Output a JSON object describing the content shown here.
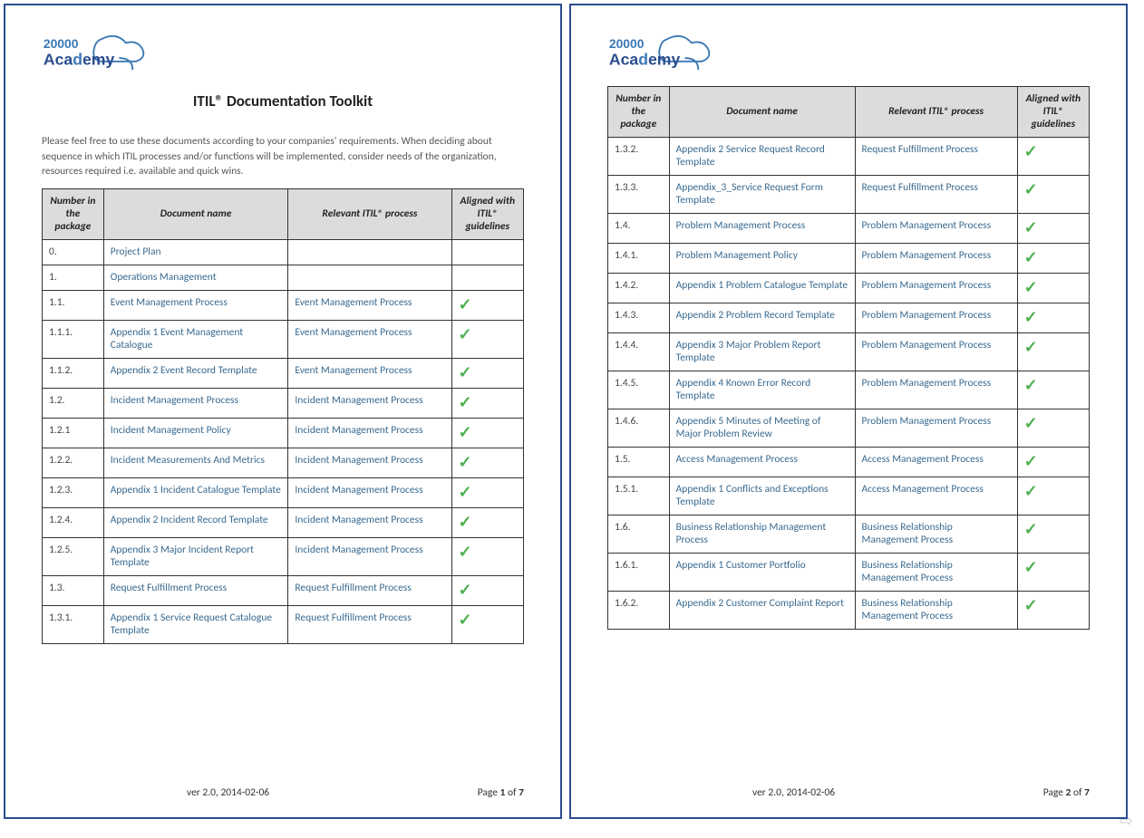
{
  "logo": {
    "top_text": "20000",
    "bottom_text": "Academy"
  },
  "title": "ITIL® Documentation Toolkit",
  "intro": "Please feel free to use these documents according to your companies' requirements. When deciding about sequence in which ITIL processes and/or functions will be implemented, consider needs of the organization, resources required i.e. available and quick wins.",
  "headers": {
    "number": "Number in the package",
    "doc": "Document name",
    "proc": "Relevant ITIL® process",
    "aligned": "Aligned with ITIL® guidelines"
  },
  "page1_rows": [
    {
      "num": "0.",
      "doc": "Project Plan",
      "proc": "",
      "check": false
    },
    {
      "num": "1.",
      "doc": "Operations Management",
      "proc": "",
      "check": false
    },
    {
      "num": "1.1.",
      "doc": "Event Management Process",
      "proc": "Event Management Process",
      "check": true
    },
    {
      "num": "1.1.1.",
      "doc": "Appendix 1 Event Management Catalogue",
      "proc": "Event Management Process",
      "check": true
    },
    {
      "num": "1.1.2.",
      "doc": "Appendix 2 Event Record Template",
      "proc": "Event Management Process",
      "check": true
    },
    {
      "num": "1.2.",
      "doc": "Incident Management Process",
      "proc": "Incident Management Process",
      "check": true
    },
    {
      "num": "1.2.1",
      "doc": "Incident Management Policy",
      "proc": "Incident Management Process",
      "check": true
    },
    {
      "num": "1.2.2.",
      "doc": "Incident Measurements And Metrics",
      "proc": "Incident Management Process",
      "check": true
    },
    {
      "num": "1.2.3.",
      "doc": "Appendix 1 Incident Catalogue Template",
      "proc": "Incident Management Process",
      "check": true
    },
    {
      "num": "1.2.4.",
      "doc": "Appendix 2 Incident Record Template",
      "proc": "Incident Management Process",
      "check": true
    },
    {
      "num": "1.2.5.",
      "doc": "Appendix 3 Major Incident Report Template",
      "proc": "Incident Management Process",
      "check": true
    },
    {
      "num": "1.3.",
      "doc": "Request Fulfillment Process",
      "proc": "Request Fulfillment Process",
      "check": true
    },
    {
      "num": "1.3.1.",
      "doc": "Appendix 1 Service Request Catalogue Template",
      "proc": "Request Fulfillment Process",
      "check": true
    }
  ],
  "page2_rows": [
    {
      "num": "1.3.2.",
      "doc": "Appendix 2 Service Request Record Template",
      "proc": "Request Fulfillment Process",
      "check": true
    },
    {
      "num": "1.3.3.",
      "doc": "Appendix_3_Service Request Form Template",
      "proc": "Request Fulfillment Process",
      "check": true
    },
    {
      "num": "1.4.",
      "doc": "Problem Management Process",
      "proc": "Problem Management Process",
      "check": true
    },
    {
      "num": "1.4.1.",
      "doc": "Problem Management Policy",
      "proc": "Problem Management Process",
      "check": true
    },
    {
      "num": "1.4.2.",
      "doc": "Appendix 1 Problem Catalogue Template",
      "proc": "Problem Management Process",
      "check": true
    },
    {
      "num": "1.4.3.",
      "doc": "Appendix 2 Problem Record Template",
      "proc": "Problem Management Process",
      "check": true
    },
    {
      "num": "1.4.4.",
      "doc": "Appendix 3 Major Problem Report Template",
      "proc": "Problem Management Process",
      "check": true
    },
    {
      "num": "1.4.5.",
      "doc": "Appendix 4 Known Error Record Template",
      "proc": "Problem Management Process",
      "check": true
    },
    {
      "num": "1.4.6.",
      "doc": "Appendix 5 Minutes of Meeting of Major Problem Review",
      "proc": "Problem Management Process",
      "check": true
    },
    {
      "num": "1.5.",
      "doc": "Access Management Process",
      "proc": "Access Management Process",
      "check": true
    },
    {
      "num": "1.5.1.",
      "doc": "Appendix 1 Conflicts and Exceptions Template",
      "proc": "Access Management Process",
      "check": true
    },
    {
      "num": "1.6.",
      "doc": "Business Relationship Management Process",
      "proc": "Business Relationship Management Process",
      "check": true
    },
    {
      "num": "1.6.1.",
      "doc": "Appendix 1 Customer Portfolio",
      "proc": "Business Relationship Management Process",
      "check": true
    },
    {
      "num": "1.6.2.",
      "doc": "Appendix 2 Customer Complaint Report",
      "proc": "Business Relationship Management Process",
      "check": true
    }
  ],
  "footer": {
    "version": "ver  2.0, 2014-02-06",
    "page1": {
      "label": "Page ",
      "current": "1",
      "of": " of ",
      "total": "7"
    },
    "page2": {
      "label": "Page ",
      "current": "2",
      "of": " of ",
      "total": "7"
    }
  }
}
